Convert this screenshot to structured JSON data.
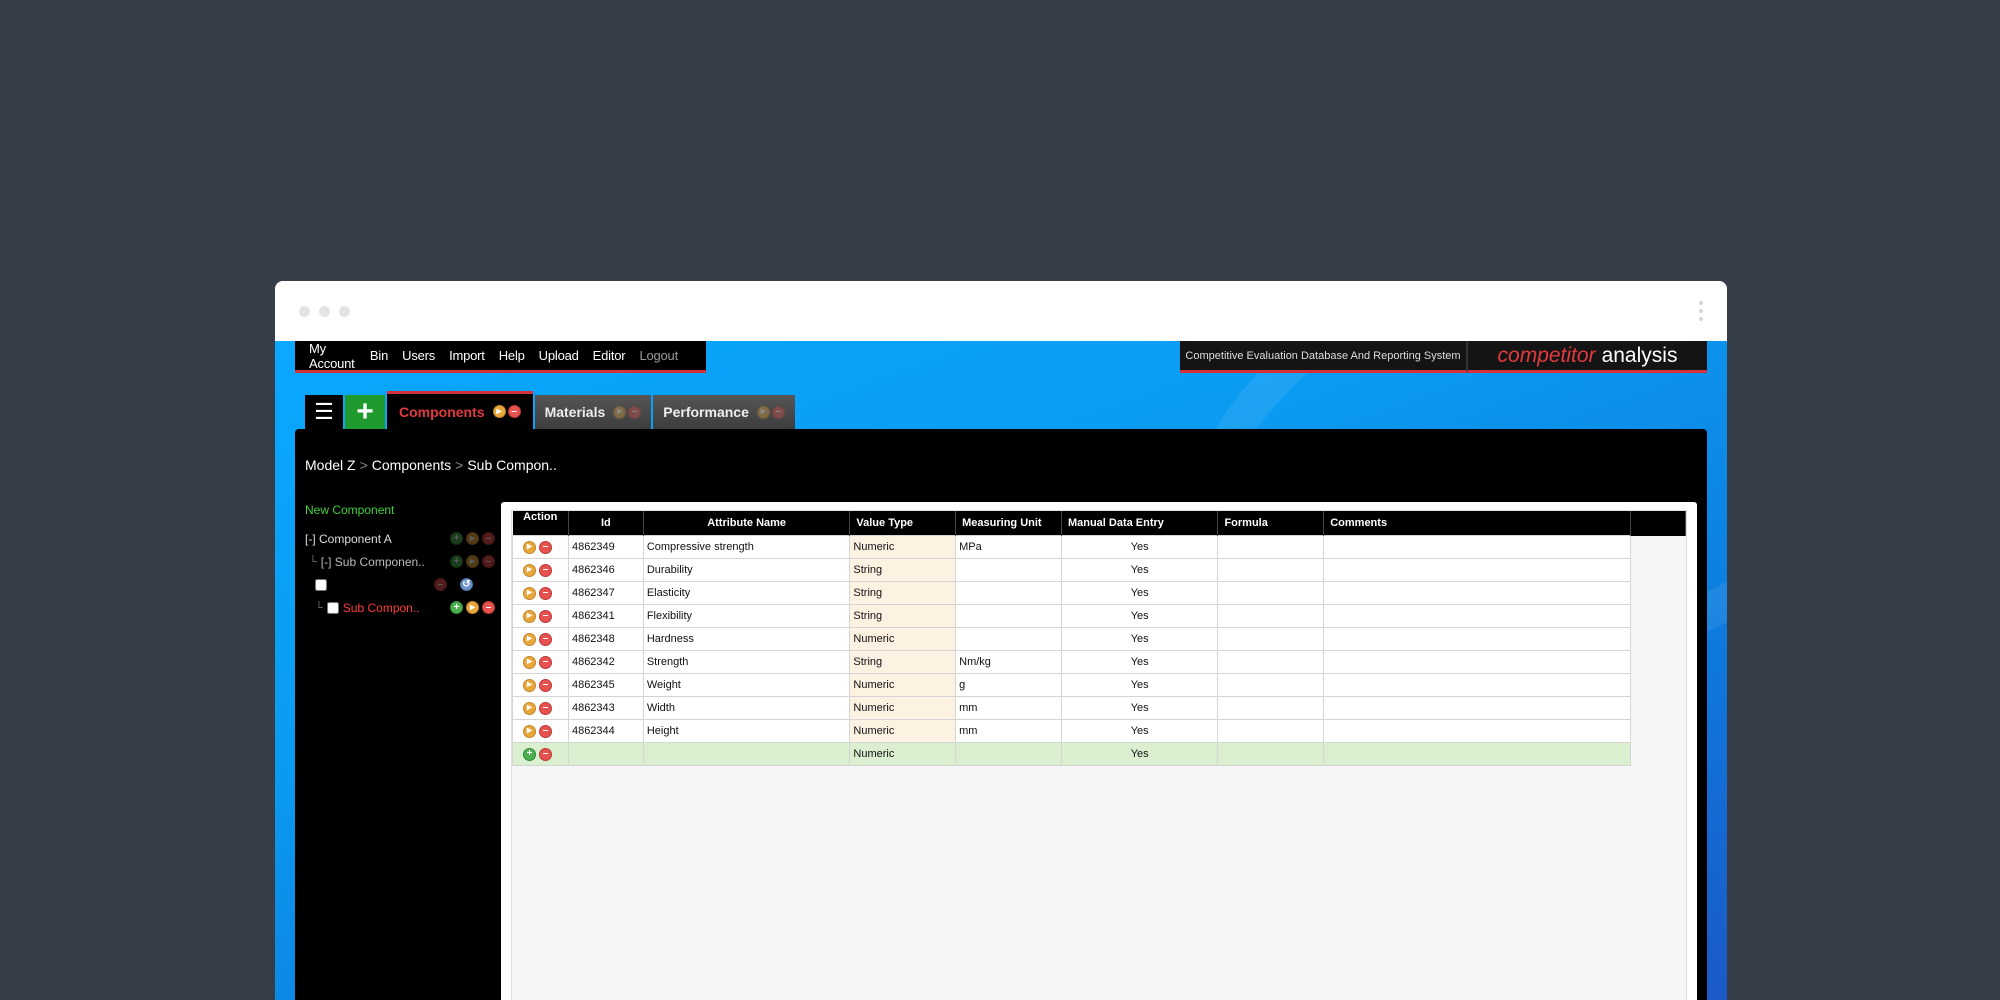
{
  "topnav": {
    "items": [
      "My Account",
      "Bin",
      "Users",
      "Import",
      "Help",
      "Upload",
      "Editor",
      "Logout"
    ]
  },
  "system_name": "Competitive Evaluation Database And Reporting System",
  "brand": {
    "part1": "competitor",
    "part2": "analysis"
  },
  "tabs": {
    "menu_icon": "☰",
    "add_icon": "+",
    "items": [
      {
        "label": "Components",
        "active": true
      },
      {
        "label": "Materials",
        "active": false
      },
      {
        "label": "Performance",
        "active": false
      }
    ]
  },
  "breadcrumb": {
    "items": [
      "Model Z",
      "Components",
      "Sub Compon.."
    ],
    "separator": ">"
  },
  "tree": {
    "new_label": "New Component",
    "nodes": [
      {
        "label": "[-] Component A"
      },
      {
        "label": "[-] Sub Componen.."
      },
      {
        "label": ""
      },
      {
        "label": "Sub Compon.."
      }
    ]
  },
  "table": {
    "headers": [
      "Action",
      "Id",
      "Attribute Name",
      "Value Type",
      "Measuring Unit",
      "Manual Data Entry",
      "Formula",
      "Comments"
    ],
    "rows": [
      {
        "id": "4862349",
        "name": "Compressive strength",
        "type": "Numeric",
        "unit": "MPa",
        "manual": "Yes"
      },
      {
        "id": "4862346",
        "name": "Durability",
        "type": "String",
        "unit": "",
        "manual": "Yes"
      },
      {
        "id": "4862347",
        "name": "Elasticity",
        "type": "String",
        "unit": "",
        "manual": "Yes"
      },
      {
        "id": "4862341",
        "name": "Flexibility",
        "type": "String",
        "unit": "",
        "manual": "Yes"
      },
      {
        "id": "4862348",
        "name": "Hardness",
        "type": "Numeric",
        "unit": "",
        "manual": "Yes"
      },
      {
        "id": "4862342",
        "name": "Strength",
        "type": "String",
        "unit": "Nm/kg",
        "manual": "Yes"
      },
      {
        "id": "4862345",
        "name": "Weight",
        "type": "Numeric",
        "unit": "g",
        "manual": "Yes"
      },
      {
        "id": "4862343",
        "name": "Width",
        "type": "Numeric",
        "unit": "mm",
        "manual": "Yes"
      },
      {
        "id": "4862344",
        "name": "Height",
        "type": "Numeric",
        "unit": "mm",
        "manual": "Yes"
      }
    ],
    "new_row": {
      "type": "Numeric",
      "manual": "Yes"
    }
  },
  "icons": {
    "play": "play-icon",
    "delete": "delete-icon",
    "add": "add-icon",
    "info": "info-icon"
  },
  "colors": {
    "accent_red": "#d4323a",
    "add_green": "#1e9a2e",
    "tree_new": "#3fd13f",
    "value_type_bg": "#fdf1e2",
    "new_row_bg": "#d9efcf"
  }
}
